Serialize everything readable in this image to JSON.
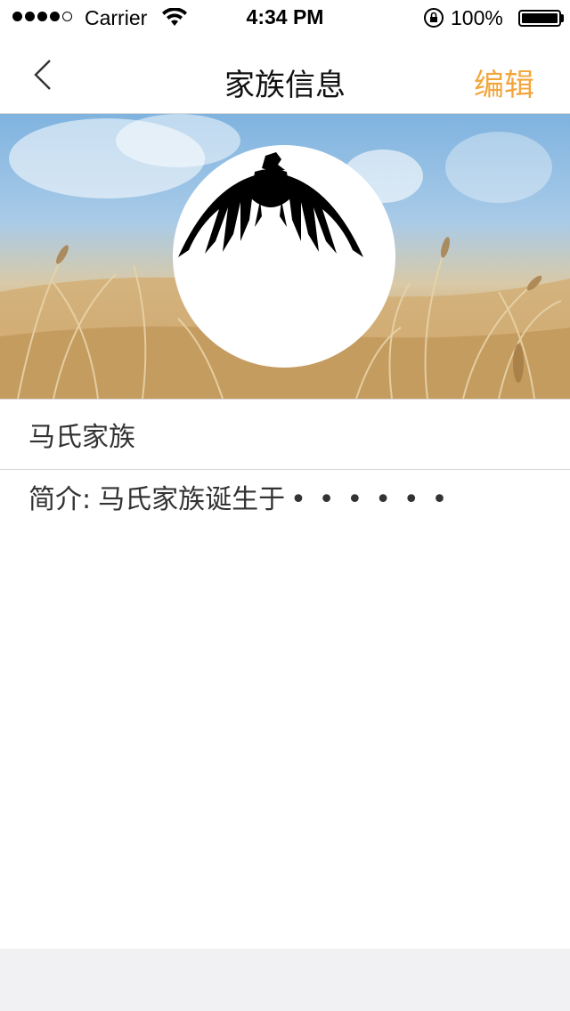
{
  "status_bar": {
    "carrier": "Carrier",
    "time": "4:34 PM",
    "battery": "100%"
  },
  "nav": {
    "title": "家族信息",
    "edit_label": "编辑",
    "back_icon": "chevron-left-icon"
  },
  "family": {
    "name": "马氏家族",
    "intro_label": "简介:",
    "intro_text": "马氏家族诞生于",
    "intro_ellipsis": "••••••"
  },
  "colors": {
    "accent": "#f2a63d",
    "divider": "#d6d6d6",
    "footer": "#f1f1f3"
  }
}
